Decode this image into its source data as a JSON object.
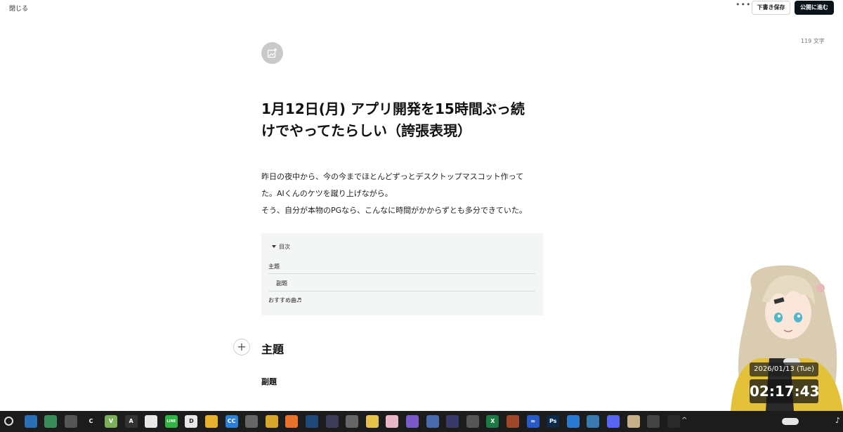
{
  "topbar": {
    "close_label": "閉じる",
    "more_label": "•••",
    "draft_label": "下書き保存",
    "publish_label": "公開に進む"
  },
  "char_count": "119 文字",
  "article": {
    "title_line1": "1月12日(月) アプリ開発を15時間ぶっ続",
    "title_line2": "けでやってたらしい（誇張表現）",
    "paragraphs": [
      "昨日の夜中から、今の今までほとんどずっとデスクトップマスコット作って",
      "た。AIくんのケツを蹴り上げながら。",
      "そう、自分が本物のPGなら、こんなに時間がかからずとも多分できていた。"
    ],
    "toc": {
      "header": "目次",
      "items": [
        "主題",
        "副題",
        "おすすめ曲♬"
      ]
    },
    "heading2": "主題",
    "heading3": "副題"
  },
  "clock": {
    "date": "2026/01/13 (Tue)",
    "time": "02:17:43"
  },
  "colors": {
    "publish_bg": "#08131a",
    "toc_bg": "#f4f6f6",
    "taskbar_bg": "#1c1c1c"
  },
  "taskbar": {
    "icons": [
      {
        "name": "search-icon",
        "glyph": "",
        "color": "#1c1c1c"
      },
      {
        "name": "widgets-icon",
        "glyph": "",
        "color": "#2a6fb5"
      },
      {
        "name": "app-green-icon",
        "glyph": "",
        "color": "#3a8c5a"
      },
      {
        "name": "app-clock-icon",
        "glyph": "",
        "color": "#555555"
      },
      {
        "name": "app-c-icon",
        "glyph": "C",
        "color": "#1c1c1c"
      },
      {
        "name": "app-v-icon",
        "glyph": "V",
        "color": "#7cae5a"
      },
      {
        "name": "app-a-icon",
        "glyph": "A",
        "color": "#333333"
      },
      {
        "name": "app-chat-icon",
        "glyph": "",
        "color": "#e8e8e8"
      },
      {
        "name": "line-icon",
        "glyph": "LINE",
        "color": "#2fb544"
      },
      {
        "name": "app-d-icon",
        "glyph": "D",
        "color": "#e8e8e8"
      },
      {
        "name": "folder-icon",
        "glyph": "",
        "color": "#e6b22e"
      },
      {
        "name": "app-cc-icon",
        "glyph": "CC",
        "color": "#2980d9"
      },
      {
        "name": "app-person-icon",
        "glyph": "",
        "color": "#666666"
      },
      {
        "name": "chrome-icon",
        "glyph": "",
        "color": "#d8a62a"
      },
      {
        "name": "firefox-icon",
        "glyph": "",
        "color": "#e8732a"
      },
      {
        "name": "steam-icon",
        "glyph": "",
        "color": "#1f4a7a"
      },
      {
        "name": "app-media-icon",
        "glyph": "",
        "color": "#3d3d5c"
      },
      {
        "name": "app-books-icon",
        "glyph": "",
        "color": "#666666"
      },
      {
        "name": "app-yellow-icon",
        "glyph": "",
        "color": "#e5c34a"
      },
      {
        "name": "app-pink-icon",
        "glyph": "",
        "color": "#e8b8c8"
      },
      {
        "name": "app-purple-icon",
        "glyph": "",
        "color": "#7a5ac8"
      },
      {
        "name": "app-feather-icon",
        "glyph": "",
        "color": "#4a6ab0"
      },
      {
        "name": "app-anime-icon",
        "glyph": "",
        "color": "#3a3a6a"
      },
      {
        "name": "unity-icon",
        "glyph": "",
        "color": "#555555"
      },
      {
        "name": "excel-icon",
        "glyph": "X",
        "color": "#1d7a44"
      },
      {
        "name": "app-fire-icon",
        "glyph": "",
        "color": "#a0462a"
      },
      {
        "name": "meta-icon",
        "glyph": "∞",
        "color": "#2a5ac8"
      },
      {
        "name": "photoshop-icon",
        "glyph": "Ps",
        "color": "#0b2a4a"
      },
      {
        "name": "vscode-icon",
        "glyph": "",
        "color": "#2a7ad0"
      },
      {
        "name": "notepad-icon",
        "glyph": "",
        "color": "#3a7ab0"
      },
      {
        "name": "discord-icon",
        "glyph": "",
        "color": "#5865f2"
      },
      {
        "name": "app-play-icon",
        "glyph": "",
        "color": "#c8b08a"
      },
      {
        "name": "app-dark-icon",
        "glyph": "",
        "color": "#444444"
      },
      {
        "name": "terminal-icon",
        "glyph": "",
        "color": "#2a2a2a"
      }
    ]
  }
}
